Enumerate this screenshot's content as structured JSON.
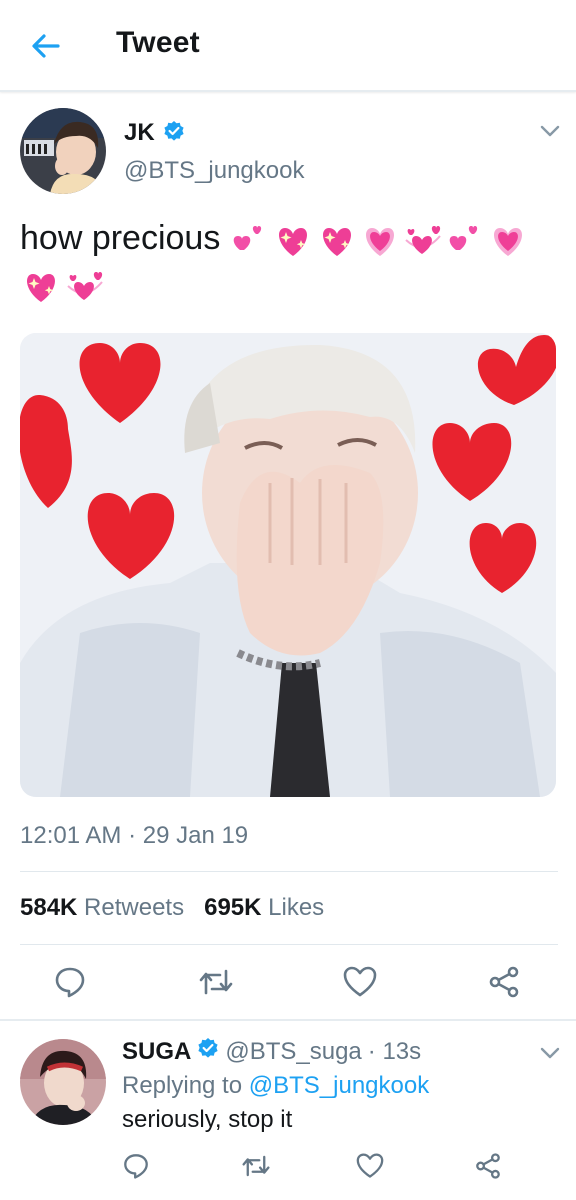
{
  "header": {
    "title": "Tweet"
  },
  "tweet": {
    "name": "JK",
    "handle": "@BTS_jungkook",
    "text": "how precious",
    "emojis": [
      "two-hearts",
      "sparkling-heart",
      "sparkling-heart",
      "heart-with-ribbon",
      "revolving-hearts",
      "two-hearts",
      "heart-with-ribbon",
      "sparkling-heart",
      "revolving-hearts"
    ],
    "timestamp": "12:01 AM · 29 Jan 19",
    "retweets_count": "584K",
    "retweets_label": "Retweets",
    "likes_count": "695K",
    "likes_label": "Likes"
  },
  "reply": {
    "name": "SUGA",
    "handle": "@BTS_suga",
    "time": "· 13s",
    "replying_prefix": "Replying to",
    "replying_to": "@BTS_jungkook",
    "text": "seriously, stop it"
  },
  "colors": {
    "accent": "#1da1f2",
    "muted": "#657786",
    "heart": "#e0245e"
  }
}
